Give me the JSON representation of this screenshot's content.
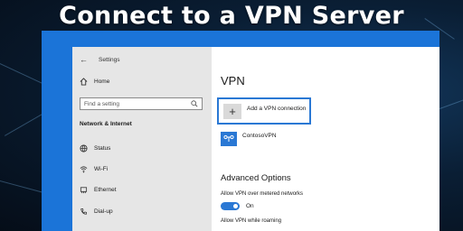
{
  "headline": "Connect to a VPN Server",
  "window": {
    "title": "Settings"
  },
  "sidebar": {
    "home_label": "Home",
    "search_placeholder": "Find a setting",
    "section_title": "Network & Internet",
    "items": [
      {
        "label": "Status",
        "icon": "globe-icon"
      },
      {
        "label": "Wi-Fi",
        "icon": "wifi-icon"
      },
      {
        "label": "Ethernet",
        "icon": "ethernet-icon"
      },
      {
        "label": "Dial-up",
        "icon": "phone-icon"
      }
    ]
  },
  "main": {
    "page_title": "VPN",
    "add_vpn_label": "Add a VPN connection",
    "connections": [
      {
        "name": "ContosoVPN",
        "icon": "vpn-connection-icon"
      }
    ],
    "advanced_title": "Advanced Options",
    "options": [
      {
        "label": "Allow VPN over metered networks",
        "toggle_state": "On",
        "on": true
      },
      {
        "label": "Allow VPN while roaming"
      }
    ]
  },
  "colors": {
    "accent": "#2a78d4",
    "frame_blue": "#1b74d8",
    "sidebar_bg": "#e6e6e6"
  }
}
